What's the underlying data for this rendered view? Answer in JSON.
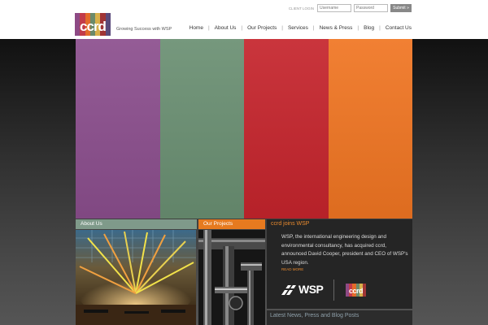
{
  "brand": {
    "logo_text": "ccrd",
    "tagline": "Growing Success with WSP",
    "stripe_colors": [
      "#8e4a85",
      "#c23b4a",
      "#e36b2a",
      "#6b8a6a",
      "#d8b04a",
      "#a03535",
      "#5a4a7a"
    ]
  },
  "login": {
    "label": "CLIENT LOGIN",
    "username_placeholder": "Username",
    "password_placeholder": "Password",
    "submit_label": "Submit »"
  },
  "nav": {
    "items": [
      {
        "label": "Home"
      },
      {
        "label": "About Us"
      },
      {
        "label": "Our Projects"
      },
      {
        "label": "Services"
      },
      {
        "label": "News & Press"
      },
      {
        "label": "Blog"
      },
      {
        "label": "Contact Us"
      }
    ],
    "separator": "|"
  },
  "hero": {
    "panel_colors": [
      "#8b4e8d",
      "#6a8f72",
      "#c5242c",
      "#f07522"
    ]
  },
  "sections": {
    "about_title": "About Us",
    "projects_title": "Our Projects"
  },
  "news": {
    "title": "ccrd joins WSP",
    "body": "WSP, the international engineering design and environmental consultancy, has acquired ccrd, announced David Cooper, president and CEO of WSP's USA region.",
    "read_more": "READ MORE",
    "wsp_text": "WSP",
    "ccrd_text": "ccrd"
  },
  "latest": {
    "title": "Latest News, Press and Blog Posts"
  },
  "colors": {
    "accent_orange": "#e88a2e",
    "about_header": "#7f9a8a",
    "projects_header": "#e67a1f"
  }
}
